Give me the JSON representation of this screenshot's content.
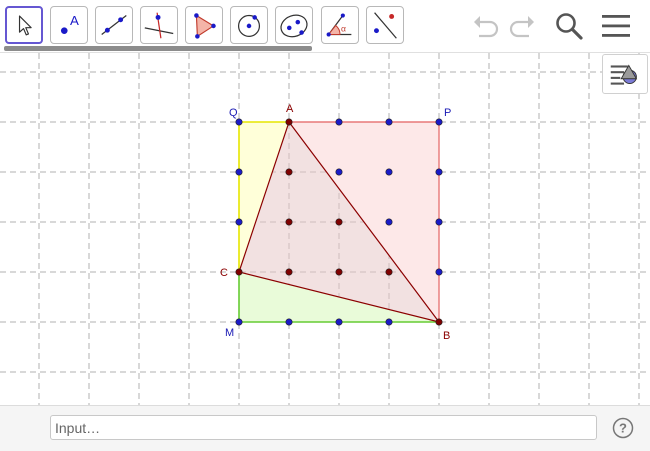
{
  "toolbar": {
    "tools": [
      {
        "id": "move",
        "active": true
      },
      {
        "id": "point",
        "label": "A"
      },
      {
        "id": "line"
      },
      {
        "id": "perpendicular"
      },
      {
        "id": "polygon"
      },
      {
        "id": "circle"
      },
      {
        "id": "ellipse"
      },
      {
        "id": "angle",
        "label": "α"
      },
      {
        "id": "reflect"
      }
    ],
    "actions": [
      "undo-icon",
      "redo-icon",
      "search-icon",
      "menu-icon"
    ]
  },
  "colors": {
    "accent": "#6557d2",
    "free_point": "#1a1ac8",
    "dependent_point": "#7f0000",
    "label_blue": "#1a1ab4",
    "label_dark_red": "#8b0000",
    "yellow_fill": "#ffffd9",
    "yellow_edge": "#e6e600",
    "green_fill": "#e9fbd9",
    "green_edge": "#66cc33",
    "red_fill": "#fde8e8",
    "red_edge": "#e87878",
    "triangle_fill": "#e8c8c8",
    "triangle_edge": "#8b0000",
    "grid": "#b0b0b0"
  },
  "graphics": {
    "grid_points": [
      [
        0,
        0
      ],
      [
        1,
        0
      ],
      [
        2,
        0
      ],
      [
        3,
        0
      ],
      [
        4,
        0
      ],
      [
        0,
        1
      ],
      [
        1,
        1
      ],
      [
        2,
        1
      ],
      [
        3,
        1
      ],
      [
        4,
        1
      ],
      [
        0,
        2
      ],
      [
        1,
        2
      ],
      [
        2,
        2
      ],
      [
        3,
        2
      ],
      [
        4,
        2
      ],
      [
        0,
        3
      ],
      [
        1,
        3
      ],
      [
        2,
        3
      ],
      [
        3,
        3
      ],
      [
        4,
        3
      ],
      [
        0,
        4
      ],
      [
        1,
        4
      ],
      [
        2,
        4
      ],
      [
        3,
        4
      ],
      [
        4,
        4
      ]
    ],
    "dependent_points": [
      [
        1,
        0
      ],
      [
        1,
        1
      ],
      [
        1,
        2
      ],
      [
        1,
        3
      ],
      [
        2,
        2
      ],
      [
        2,
        3
      ],
      [
        3,
        3
      ],
      [
        0,
        3
      ],
      [
        4,
        4
      ]
    ],
    "labels": [
      {
        "text": "Q",
        "at": [
          0,
          0
        ],
        "color": "label_blue"
      },
      {
        "text": "A",
        "at": [
          1,
          0
        ],
        "color": "label_dark_red"
      },
      {
        "text": "P",
        "at": [
          4,
          0
        ],
        "color": "label_blue"
      },
      {
        "text": "C",
        "at": [
          0,
          3
        ],
        "color": "label_dark_red"
      },
      {
        "text": "M",
        "at": [
          0,
          4
        ],
        "color": "label_blue"
      },
      {
        "text": "B",
        "at": [
          4,
          4
        ],
        "color": "label_dark_red"
      }
    ],
    "triangle": {
      "A": [
        1,
        0
      ],
      "B": [
        4,
        4
      ],
      "C": [
        0,
        3
      ]
    }
  },
  "input": {
    "placeholder": "Input…"
  }
}
